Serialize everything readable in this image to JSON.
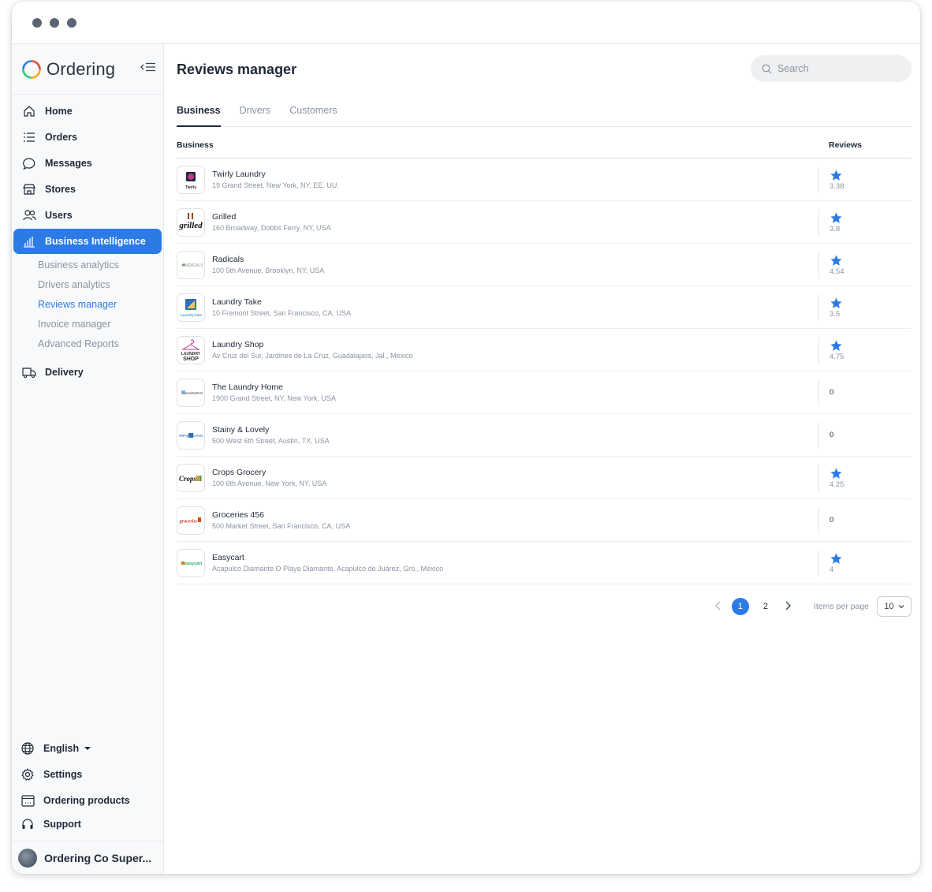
{
  "app": {
    "brand": "Ordering"
  },
  "nav": {
    "items": [
      {
        "label": "Home",
        "icon": "home-icon"
      },
      {
        "label": "Orders",
        "icon": "list-icon"
      },
      {
        "label": "Messages",
        "icon": "chat-icon"
      },
      {
        "label": "Stores",
        "icon": "store-icon"
      },
      {
        "label": "Users",
        "icon": "users-icon"
      },
      {
        "label": "Business Intelligence",
        "icon": "chart-icon"
      }
    ],
    "sub_items": [
      "Business analytics",
      "Drivers analytics",
      "Reviews manager",
      "Invoice manager",
      "Advanced Reports"
    ],
    "delivery": "Delivery"
  },
  "bottom": {
    "language": "English",
    "settings": "Settings",
    "products": "Ordering products",
    "support": "Support",
    "user_name": "Ordering Co Super..."
  },
  "header": {
    "title": "Reviews manager",
    "search_placeholder": "Search"
  },
  "tabs": [
    "Business",
    "Drivers",
    "Customers"
  ],
  "table": {
    "col_business": "Business",
    "col_reviews": "Reviews",
    "rows": [
      {
        "name": "Twirly Laundry",
        "address": "19 Grand Street, New York, NY, EE. UU.",
        "rating": "3.38",
        "has_star": true
      },
      {
        "name": "Grilled",
        "address": "160 Broadway, Dobbs Ferry, NY, USA",
        "rating": "3.8",
        "has_star": true
      },
      {
        "name": "Radicals",
        "address": "100 5th Avenue, Brooklyn, NY, USA",
        "rating": "4.54",
        "has_star": true
      },
      {
        "name": "Laundry Take",
        "address": "10 Fremont Street, San Francisco, CA, USA",
        "rating": "3.5",
        "has_star": true
      },
      {
        "name": "Laundry Shop",
        "address": "Av Cruz del Sur, Jardines de La Cruz, Guadalajara, Jal., Mexico",
        "rating": "4.75",
        "has_star": true
      },
      {
        "name": "The Laundry Home",
        "address": "1900 Grand Street, NY, New York, USA",
        "rating": "0",
        "has_star": false
      },
      {
        "name": "Stainy & Lovely",
        "address": "500 West 6th Street, Austin, TX, USA",
        "rating": "0",
        "has_star": false
      },
      {
        "name": "Crops Grocery",
        "address": "100 6th Avenue, New York, NY, USA",
        "rating": "4.25",
        "has_star": true
      },
      {
        "name": "Groceries 456",
        "address": "500 Market Street, San Francisco, CA, USA",
        "rating": "0",
        "has_star": false
      },
      {
        "name": "Easycart",
        "address": "Acapulco Diamante O Playa Diamante, Acapulco de Juárez, Gro., México",
        "rating": "4",
        "has_star": true
      }
    ]
  },
  "pagination": {
    "pages": [
      "1",
      "2"
    ],
    "current": "1",
    "items_per_page_label": "Items per page",
    "items_per_page": "10"
  },
  "colors": {
    "accent": "#2c7be5",
    "text": "#1f2937",
    "muted": "#8a94a2"
  }
}
